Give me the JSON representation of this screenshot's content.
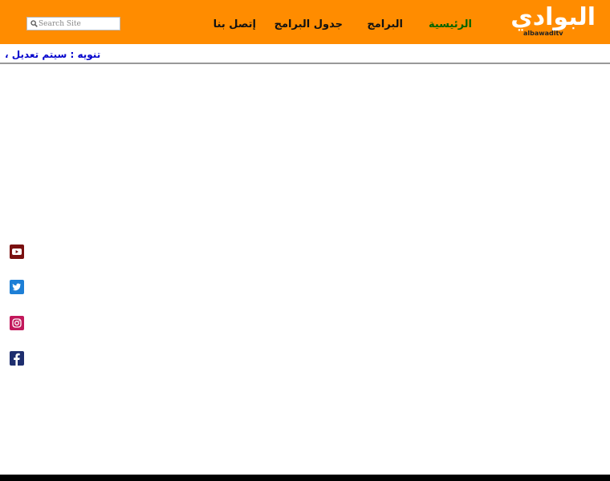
{
  "logo": {
    "text": "البوادي",
    "subtitle": "albawaditv",
    "icon": "albawadi-logo"
  },
  "nav": {
    "items": [
      {
        "label": "الرئيسية",
        "active": true
      },
      {
        "label": "البرامج",
        "active": false
      },
      {
        "label": "جدول البرامج",
        "active": false
      },
      {
        "label": "إتصل بنا",
        "active": false
      }
    ]
  },
  "search": {
    "placeholder": "Search Site",
    "value": "",
    "icon": "search-icon"
  },
  "notice": {
    "text": "تنويه : سيتم تعديل ،"
  },
  "social": [
    {
      "icon": "youtube-icon",
      "color": "#cc0000"
    },
    {
      "icon": "twitter-icon",
      "color": "#1da1f2"
    },
    {
      "icon": "instagram-icon",
      "color": "#c13584"
    },
    {
      "icon": "facebook-icon",
      "color": "#1e2e6e"
    }
  ],
  "colors": {
    "header_bg": "#ff8c00",
    "nav_text": "#111111",
    "nav_active": "#006400",
    "notice_text": "#0000cc",
    "footer_bg": "#000000"
  }
}
